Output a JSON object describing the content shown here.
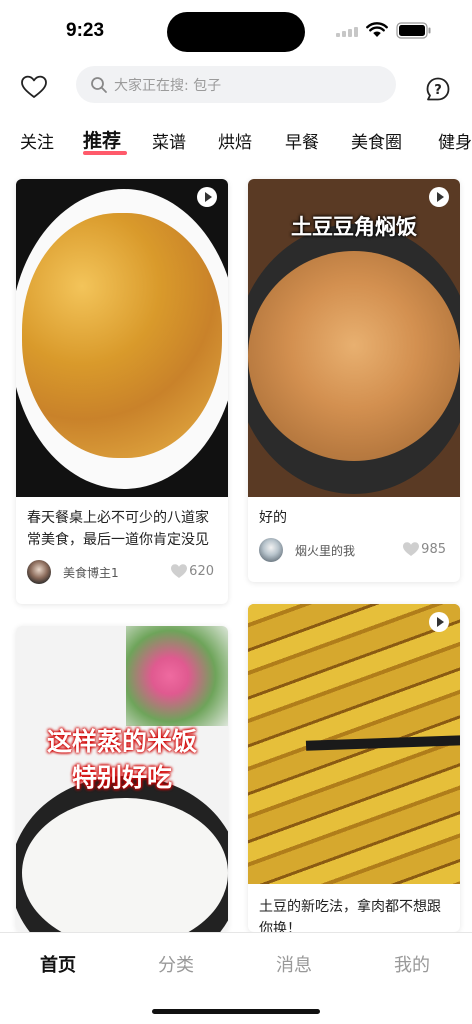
{
  "status_bar": {
    "time": "9:23"
  },
  "search": {
    "placeholder": "大家正在搜: 包子"
  },
  "tabs": [
    "关注",
    "推荐",
    "菜谱",
    "烘焙",
    "早餐",
    "美食圈",
    "健身"
  ],
  "active_tab_index": 1,
  "feed": [
    {
      "title_line1": "春天餐桌上必不可少的八道家",
      "title_line2": "常美食，最后一道你肯定没见",
      "author": "美食博主1",
      "likes": "620",
      "has_video": true
    },
    {
      "title": "好的",
      "author": "烟火里的我",
      "likes": "985",
      "has_video": true,
      "image_caption": "土豆豆角焖饭"
    },
    {
      "image_caption_line1": "这样蒸的米饭",
      "image_caption_line2": "特别好吃",
      "has_video": false
    },
    {
      "title_line1": "土豆的新吃法，拿肉都不想跟",
      "title_line2": "你换！",
      "has_video": true
    }
  ],
  "bottom_nav": [
    "首页",
    "分类",
    "消息",
    "我的"
  ],
  "active_nav_index": 0,
  "colors": {
    "accent": "#ff5a6b",
    "search_bg": "#f1f2f4"
  },
  "icons": [
    "heart-icon",
    "search-icon",
    "help-icon",
    "play-icon",
    "like-heart-icon"
  ]
}
